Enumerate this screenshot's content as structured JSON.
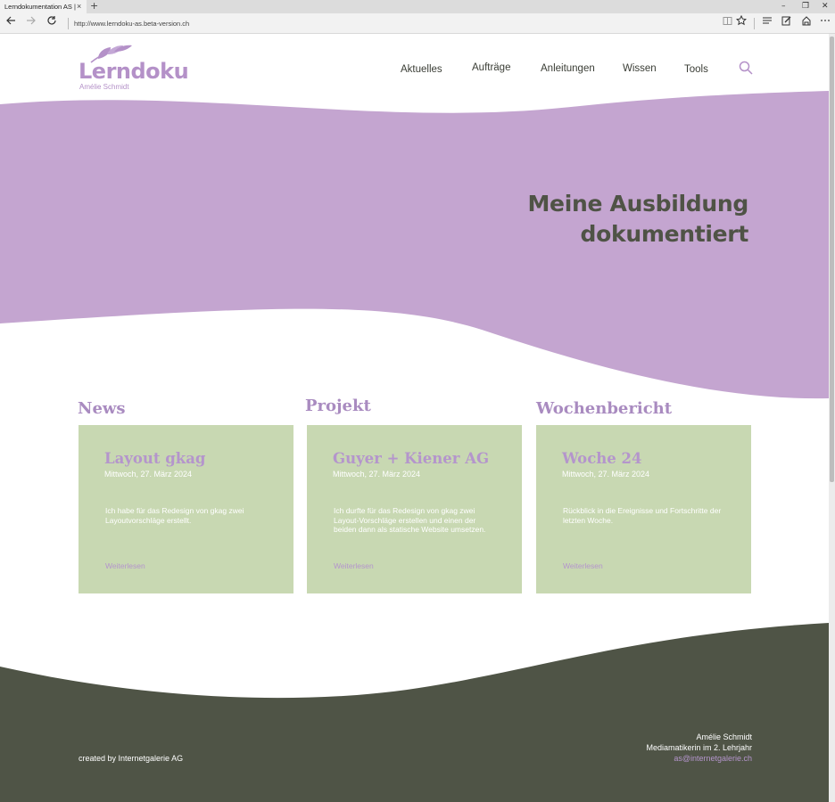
{
  "browser": {
    "tab_title": "Lerndokumentation AS |",
    "tab_close": "×",
    "new_tab": "+",
    "url": "http://www.lerndoku-as.beta-version.ch",
    "window_minimize": "–",
    "window_restore": "❐",
    "window_close": "✕"
  },
  "site": {
    "logo_text": "Lerndoku",
    "logo_subtitle": "Amélie Schmidt",
    "nav": [
      {
        "label": "Aktuelles"
      },
      {
        "label": "Aufträge"
      },
      {
        "label": "Anleitungen"
      },
      {
        "label": "Wissen"
      },
      {
        "label": "Tools"
      }
    ]
  },
  "hero": {
    "line1": "Meine Ausbildung",
    "line2": "dokumentiert"
  },
  "sections": [
    {
      "heading": "News",
      "card": {
        "title": "Layout gkag",
        "date": "Mittwoch, 27. März 2024",
        "text": "Ich habe für das Redesign von gkag zwei Layoutvorschläge erstellt.",
        "link": "Weiterlesen"
      }
    },
    {
      "heading": "Projekt",
      "card": {
        "title": "Guyer + Kiener AG",
        "date": "Mittwoch, 27. März 2024",
        "text": "Ich durfte für das Redesign von gkag zwei Layout-Vorschläge erstellen und einen der beiden dann als statische Website umsetzen.",
        "link": "Weiterlesen"
      }
    },
    {
      "heading": "Wochenbericht",
      "card": {
        "title": "Woche 24",
        "date": "Mittwoch, 27. März 2024",
        "text": "Rückblick in die Ereignisse und Fortschritte der letzten Woche.",
        "link": "Weiterlesen"
      }
    }
  ],
  "footer": {
    "credit": "created by Internetgalerie AG",
    "name": "Amélie Schmidt",
    "role": "Mediamatikerin im 2. Lehrjahr",
    "email": "as@internetgalerie.ch"
  },
  "colors": {
    "purple": "#c4a5d0",
    "accent": "#b495cc",
    "card_green": "#c8d8b2",
    "footer_dark": "#4f5446",
    "heading_dark": "#4f5346"
  },
  "icons": [
    "back-arrow-icon",
    "forward-arrow-icon",
    "refresh-icon",
    "reading-view-icon",
    "favorite-star-icon",
    "hub-icon",
    "web-note-icon",
    "share-icon",
    "more-icon",
    "search-icon",
    "leaf-icon"
  ]
}
